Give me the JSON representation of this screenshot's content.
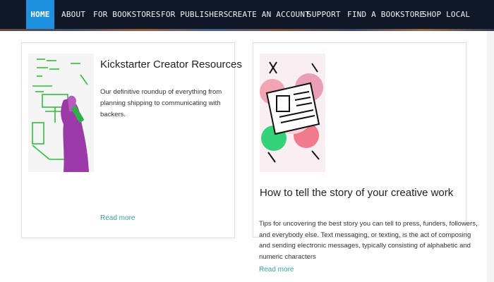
{
  "nav": {
    "items": [
      {
        "label": "HOME",
        "active": true
      },
      {
        "label": "ABOUT"
      },
      {
        "label": "FOR BOOKSTORES"
      },
      {
        "label": "FOR PUBLISHERS"
      },
      {
        "label": "CREATE AN ACCOUNT"
      },
      {
        "label": "SUPPORT"
      },
      {
        "label": "FIND A BOOKSTORE"
      },
      {
        "label": "SHOP LOCAL"
      }
    ],
    "active_color": "#1e90e0",
    "background_color": "#101827"
  },
  "cards": [
    {
      "title": "Kickstarter Creator Resources",
      "description": "Our definitive roundup of everything from planning shipping to communicating with backers.",
      "read_more": "Read more",
      "image_icon": "whiteboard-hand-image"
    },
    {
      "title": "How to tell the story of your creative work",
      "description": "Tips for uncovering the best story you can tell to press, funders, followers, and everybody else. Text messaging, or texting, is the act of composing and sending electronic messages, typically consisting of alphabetic and numeric characters",
      "read_more": "Read more",
      "image_icon": "newspaper-illustration-image"
    }
  ],
  "link_color": "#3aa3a0"
}
